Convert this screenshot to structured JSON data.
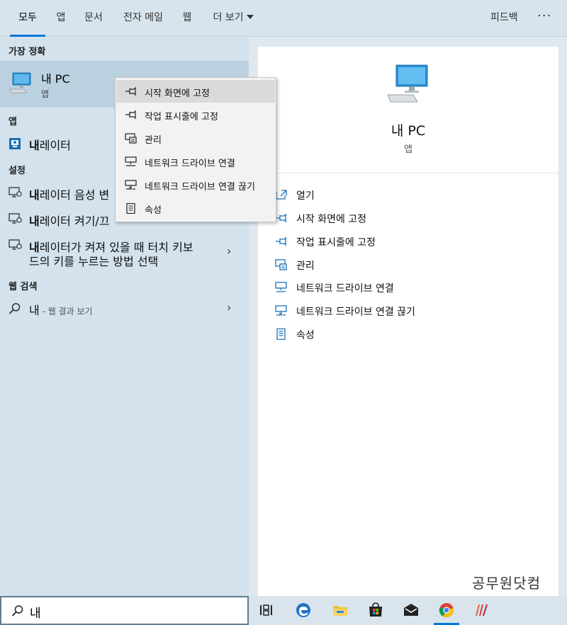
{
  "tabs": [
    {
      "label": "모두"
    },
    {
      "label": "앱"
    },
    {
      "label": "문서"
    },
    {
      "label": "전자 메일"
    },
    {
      "label": "웹"
    },
    {
      "label": "더 보기"
    }
  ],
  "header": {
    "feedback": "피드백",
    "more": "···"
  },
  "left": {
    "best_match_title": "가장 정확",
    "best_match": {
      "name": "내 PC",
      "type": "앱"
    },
    "apps_title": "앱",
    "apps": [
      {
        "bold": "내",
        "rest": "레이터"
      }
    ],
    "settings_title": "설정",
    "settings": [
      {
        "bold": "내",
        "rest": "레이터 음성 변"
      },
      {
        "bold": "내",
        "rest": "레이터 켜기/끄"
      },
      {
        "bold": "내",
        "rest": "레이터가 켜져 있을 때 터치 키보",
        "line2": "드의 키를 누르는 방법 선택"
      }
    ],
    "web_title": "웹 검색",
    "web": {
      "query": "내",
      "hint": " - 웹 결과 보기"
    }
  },
  "context_menu": [
    "시작 화면에 고정",
    "작업 표시줄에 고정",
    "관리",
    "네트워크 드라이브 연결",
    "네트워크 드라이브 연결 끊기",
    "속성"
  ],
  "right": {
    "title": "내 PC",
    "subtitle": "앱",
    "actions": [
      "열기",
      "시작 화면에 고정",
      "작업 표시줄에 고정",
      "관리",
      "네트워크 드라이브 연결",
      "네트워크 드라이브 연결 끊기",
      "속성"
    ]
  },
  "watermark": "공무원닷컴",
  "search": {
    "value": "내"
  },
  "taskbar_icons": [
    "task-view-icon",
    "edge-icon",
    "file-explorer-icon",
    "store-icon",
    "mail-icon",
    "chrome-icon",
    "app-icon"
  ],
  "colors": {
    "accent": "#0078d7"
  }
}
